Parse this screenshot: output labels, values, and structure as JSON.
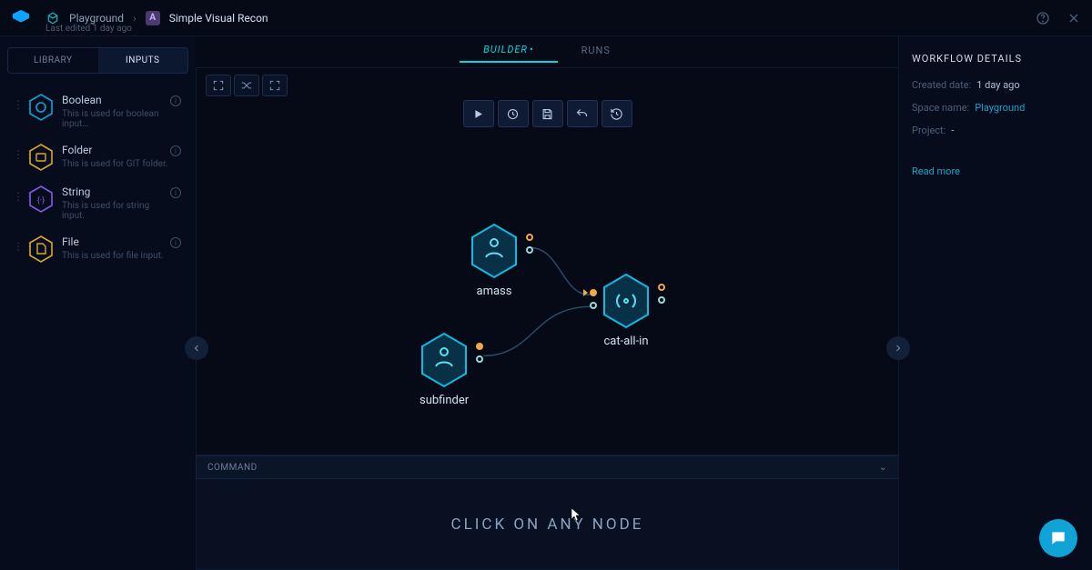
{
  "breadcrumb": {
    "space": "Playground",
    "workflow": "Simple Visual Recon",
    "last_edited": "Last edited 1 day ago"
  },
  "sidebar": {
    "tabs": {
      "library": "LIBRARY",
      "inputs": "INPUTS"
    },
    "items": [
      {
        "title": "Boolean",
        "desc": "This is used for boolean input…",
        "color": "#0fa3d6"
      },
      {
        "title": "Folder",
        "desc": "This is used for GIT folder.",
        "color": "#d9a82e"
      },
      {
        "title": "String",
        "desc": "This is used for string input.",
        "color": "#5b38c9"
      },
      {
        "title": "File",
        "desc": "This is used for file input.",
        "color": "#d9a82e"
      }
    ]
  },
  "main_tabs": {
    "builder": "BUILDER",
    "runs": "RUNS"
  },
  "nodes": {
    "amass": {
      "label": "amass"
    },
    "subfinder": {
      "label": "subfinder"
    },
    "cat_all_in": {
      "label": "cat-all-in"
    }
  },
  "command_panel": {
    "label": "COMMAND",
    "placeholder": "CLICK ON ANY NODE"
  },
  "details": {
    "title": "WORKFLOW DETAILS",
    "rows": {
      "created_label": "Created date:",
      "created_value": "1 day ago",
      "space_label": "Space name:",
      "space_value": "Playground",
      "project_label": "Project:",
      "project_value": "-"
    },
    "read_more": "Read more"
  }
}
